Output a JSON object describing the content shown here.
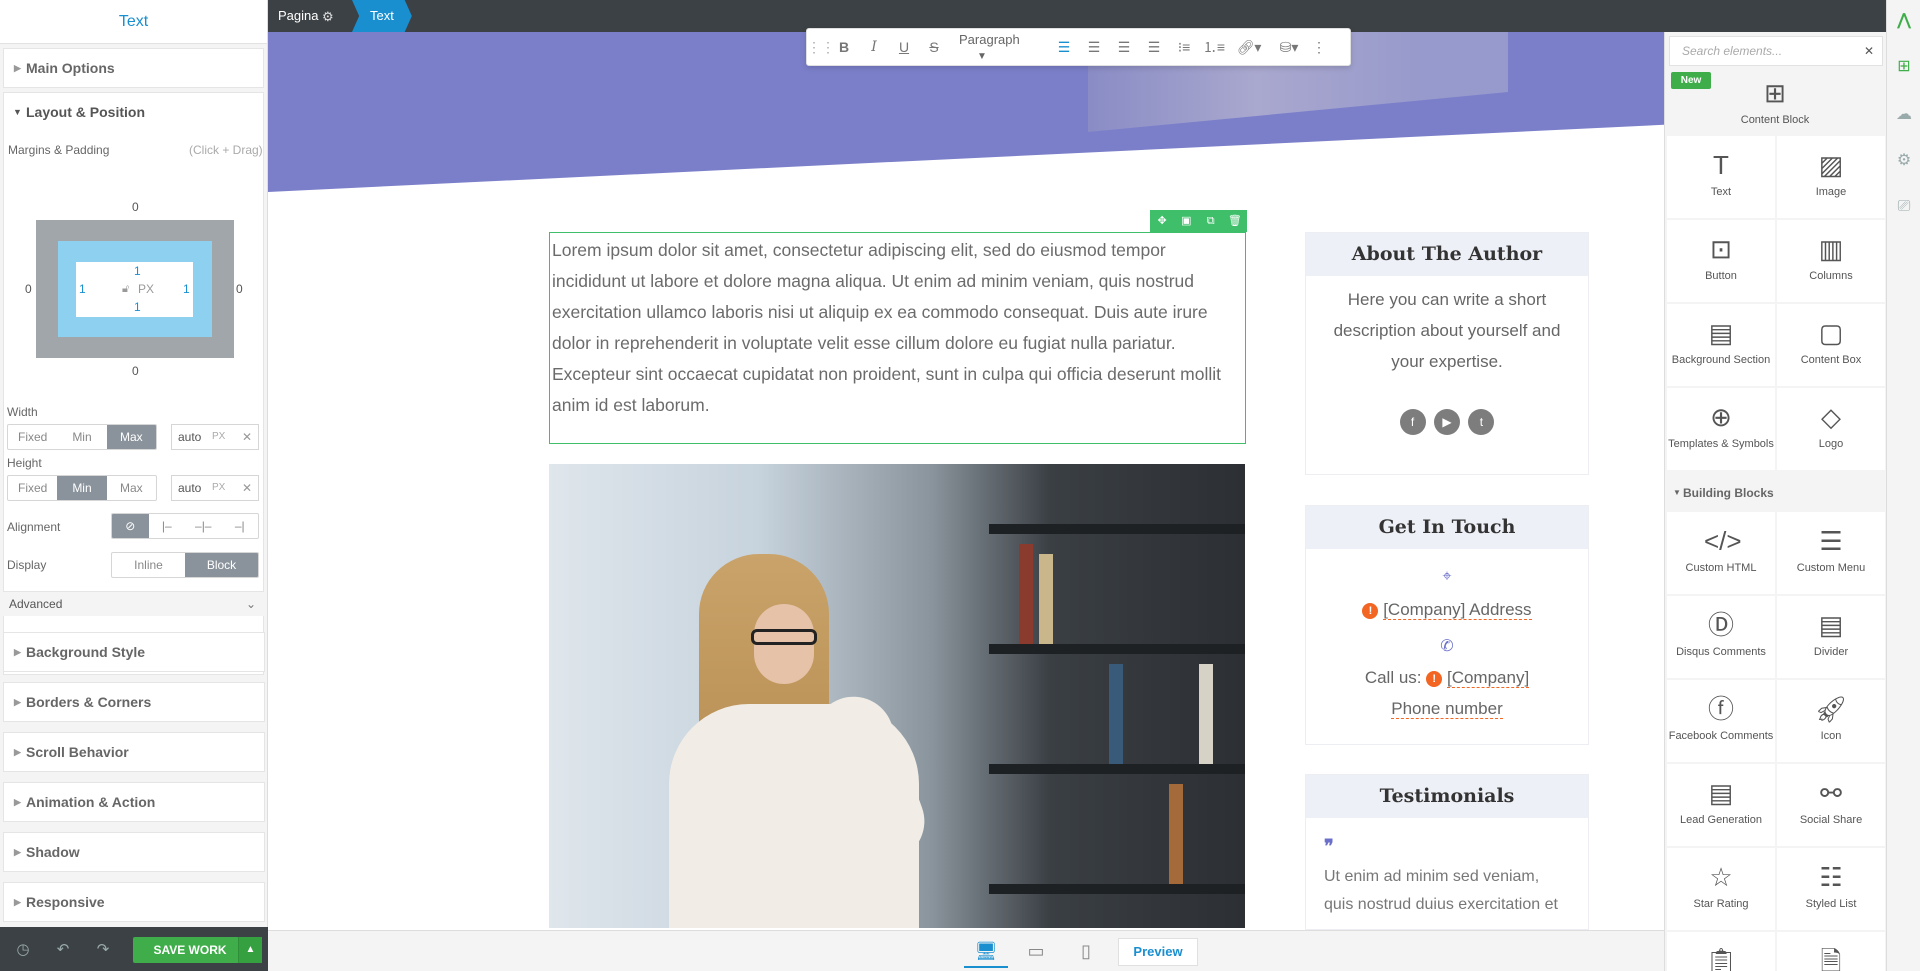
{
  "left_panel": {
    "title": "Text",
    "sections_top": [
      "Main Options"
    ],
    "layout": {
      "title": "Layout & Position",
      "margins_label": "Margins & Padding",
      "margins_hint": "(Click + Drag)",
      "margin_top": "0",
      "margin_bottom": "0",
      "margin_left": "0",
      "margin_right": "0",
      "padding_top": "1",
      "padding_bottom": "1",
      "padding_left": "1",
      "padding_right": "1",
      "unit": "PX",
      "width_label": "Width",
      "height_label": "Height",
      "size_modes": [
        "Fixed",
        "Min",
        "Max"
      ],
      "width_value": "auto",
      "height_value": "auto",
      "px_unit": "PX",
      "alignment_label": "Alignment",
      "display_label": "Display",
      "display_options": [
        "Inline",
        "Block"
      ],
      "advanced_label": "Advanced"
    },
    "sections_bottom": [
      "Background Style",
      "Borders & Corners",
      "Scroll Behavior",
      "Animation & Action",
      "Shadow",
      "Responsive"
    ],
    "save_label": "SAVE WORK"
  },
  "breadcrumb": {
    "page": "Pagina",
    "current": "Text"
  },
  "toolbar": {
    "paragraph": "Paragraph"
  },
  "content": {
    "lorem": "Lorem ipsum dolor sit amet, consectetur adipiscing elit, sed do eiusmod tempor incididunt ut labore et dolore magna aliqua. Ut enim ad minim veniam, quis nostrud exercitation ullamco laboris nisi ut aliquip ex ea commodo consequat. Duis aute irure dolor in reprehenderit in voluptate velit esse cillum dolore eu fugiat nulla pariatur. Excepteur sint occaecat cupidatat non proident, sunt in culpa qui officia deserunt mollit anim id est laborum."
  },
  "author_card": {
    "title": "About The Author",
    "body": "Here you can write a short description about yourself and your expertise."
  },
  "touch_card": {
    "title": "Get In Touch",
    "address": "[Company] Address",
    "call_prefix": "Call us:",
    "phone": "[Company] Phone number"
  },
  "testimonials_card": {
    "title": "Testimonials",
    "quote": "Ut enim ad minim sed veniam, quis nostrud duius exercitation et"
  },
  "elements_panel": {
    "search_placeholder": "Search elements...",
    "new_badge": "New",
    "featured": "Content Block",
    "basic": [
      "Text",
      "Image",
      "Button",
      "Columns",
      "Background Section",
      "Content Box",
      "Templates & Symbols",
      "Logo"
    ],
    "building_blocks_label": "Building Blocks",
    "building": [
      "Custom HTML",
      "Custom Menu",
      "Disqus Comments",
      "Divider",
      "Facebook Comments",
      "Icon",
      "Lead Generation",
      "Social Share",
      "Star Rating",
      "Styled List"
    ]
  },
  "bottom_bar": {
    "preview": "Preview"
  }
}
